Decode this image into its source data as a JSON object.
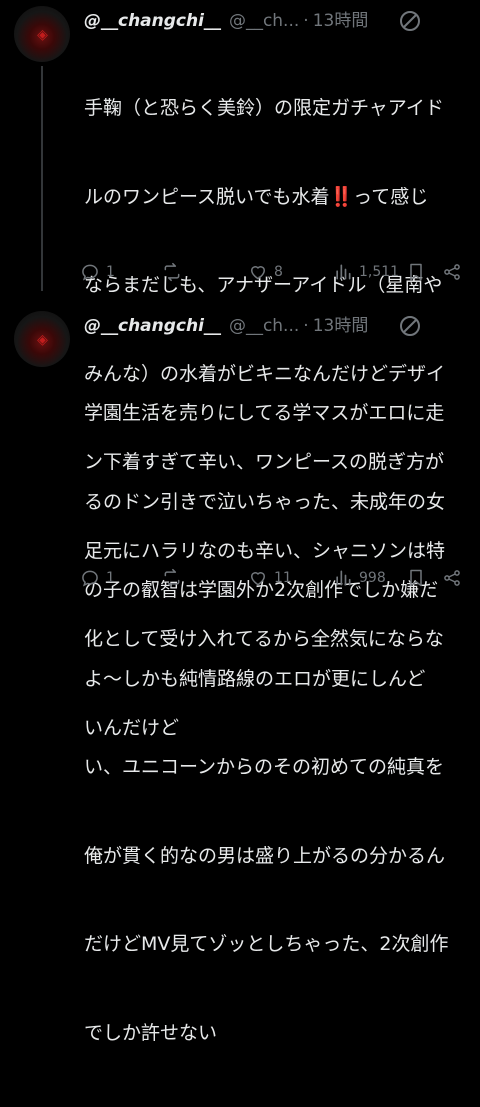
{
  "tweets": [
    {
      "name": "@__changchi__",
      "handle": "@__ch...",
      "separator": "·",
      "time": "13時間",
      "text_lines": [
        "手鞠（と恐らく美鈴）の限定ガチャアイド",
        "ルのワンピース脱いでも水着‼️って感じ",
        "ならまだしも、アナザーアイドル（星南や",
        "みんな）の水着がビキニなんだけどデザイ",
        "ン下着すぎて辛い、ワンピースの脱ぎ方が",
        "足元にハラリなのも辛い、シャニソンは特",
        "化として受け入れてるから全然気にならな",
        "いんだけど"
      ],
      "replies": "1",
      "reposts": "",
      "likes": "8",
      "views": "1,511"
    },
    {
      "name": "@__changchi__",
      "handle": "@__ch...",
      "separator": "·",
      "time": "13時間",
      "text_lines": [
        "学園生活を売りにしてる学マスがエロに走",
        "るのドン引きで泣いちゃった、未成年の女",
        "の子の叡智は学園外か2次創作でしか嫌だ",
        "よ〜しかも純情路線のエロが更にしんど",
        "い、ユニコーンからのその初めての純真を",
        "俺が貫く的なの男は盛り上がるの分かるん",
        "だけどMV見てゾッとしちゃった、2次創作",
        "でしか許せない"
      ],
      "replies": "1",
      "reposts": "",
      "likes": "11",
      "views": "998"
    }
  ],
  "icons": {
    "more": "no-entry-icon",
    "reply": "reply-icon",
    "repost": "repost-icon",
    "like": "heart-icon",
    "views": "views-bar-icon",
    "bookmark": "bookmark-icon",
    "share": "share-icon"
  },
  "colors": {
    "background": "#000000",
    "text": "#e7e9ea",
    "muted": "#71767b",
    "avatar_accent": "#c21d1d"
  }
}
